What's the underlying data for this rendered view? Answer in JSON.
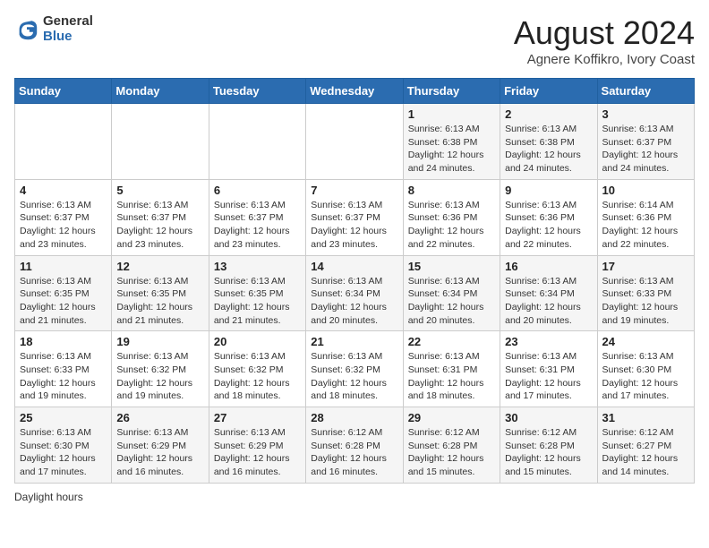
{
  "header": {
    "logo_general": "General",
    "logo_blue": "Blue",
    "month_title": "August 2024",
    "subtitle": "Agnere Koffikro, Ivory Coast"
  },
  "weekdays": [
    "Sunday",
    "Monday",
    "Tuesday",
    "Wednesday",
    "Thursday",
    "Friday",
    "Saturday"
  ],
  "weeks": [
    [
      {
        "day": "",
        "info": ""
      },
      {
        "day": "",
        "info": ""
      },
      {
        "day": "",
        "info": ""
      },
      {
        "day": "",
        "info": ""
      },
      {
        "day": "1",
        "info": "Sunrise: 6:13 AM\nSunset: 6:38 PM\nDaylight: 12 hours and 24 minutes."
      },
      {
        "day": "2",
        "info": "Sunrise: 6:13 AM\nSunset: 6:38 PM\nDaylight: 12 hours and 24 minutes."
      },
      {
        "day": "3",
        "info": "Sunrise: 6:13 AM\nSunset: 6:37 PM\nDaylight: 12 hours and 24 minutes."
      }
    ],
    [
      {
        "day": "4",
        "info": "Sunrise: 6:13 AM\nSunset: 6:37 PM\nDaylight: 12 hours and 23 minutes."
      },
      {
        "day": "5",
        "info": "Sunrise: 6:13 AM\nSunset: 6:37 PM\nDaylight: 12 hours and 23 minutes."
      },
      {
        "day": "6",
        "info": "Sunrise: 6:13 AM\nSunset: 6:37 PM\nDaylight: 12 hours and 23 minutes."
      },
      {
        "day": "7",
        "info": "Sunrise: 6:13 AM\nSunset: 6:37 PM\nDaylight: 12 hours and 23 minutes."
      },
      {
        "day": "8",
        "info": "Sunrise: 6:13 AM\nSunset: 6:36 PM\nDaylight: 12 hours and 22 minutes."
      },
      {
        "day": "9",
        "info": "Sunrise: 6:13 AM\nSunset: 6:36 PM\nDaylight: 12 hours and 22 minutes."
      },
      {
        "day": "10",
        "info": "Sunrise: 6:14 AM\nSunset: 6:36 PM\nDaylight: 12 hours and 22 minutes."
      }
    ],
    [
      {
        "day": "11",
        "info": "Sunrise: 6:13 AM\nSunset: 6:35 PM\nDaylight: 12 hours and 21 minutes."
      },
      {
        "day": "12",
        "info": "Sunrise: 6:13 AM\nSunset: 6:35 PM\nDaylight: 12 hours and 21 minutes."
      },
      {
        "day": "13",
        "info": "Sunrise: 6:13 AM\nSunset: 6:35 PM\nDaylight: 12 hours and 21 minutes."
      },
      {
        "day": "14",
        "info": "Sunrise: 6:13 AM\nSunset: 6:34 PM\nDaylight: 12 hours and 20 minutes."
      },
      {
        "day": "15",
        "info": "Sunrise: 6:13 AM\nSunset: 6:34 PM\nDaylight: 12 hours and 20 minutes."
      },
      {
        "day": "16",
        "info": "Sunrise: 6:13 AM\nSunset: 6:34 PM\nDaylight: 12 hours and 20 minutes."
      },
      {
        "day": "17",
        "info": "Sunrise: 6:13 AM\nSunset: 6:33 PM\nDaylight: 12 hours and 19 minutes."
      }
    ],
    [
      {
        "day": "18",
        "info": "Sunrise: 6:13 AM\nSunset: 6:33 PM\nDaylight: 12 hours and 19 minutes."
      },
      {
        "day": "19",
        "info": "Sunrise: 6:13 AM\nSunset: 6:32 PM\nDaylight: 12 hours and 19 minutes."
      },
      {
        "day": "20",
        "info": "Sunrise: 6:13 AM\nSunset: 6:32 PM\nDaylight: 12 hours and 18 minutes."
      },
      {
        "day": "21",
        "info": "Sunrise: 6:13 AM\nSunset: 6:32 PM\nDaylight: 12 hours and 18 minutes."
      },
      {
        "day": "22",
        "info": "Sunrise: 6:13 AM\nSunset: 6:31 PM\nDaylight: 12 hours and 18 minutes."
      },
      {
        "day": "23",
        "info": "Sunrise: 6:13 AM\nSunset: 6:31 PM\nDaylight: 12 hours and 17 minutes."
      },
      {
        "day": "24",
        "info": "Sunrise: 6:13 AM\nSunset: 6:30 PM\nDaylight: 12 hours and 17 minutes."
      }
    ],
    [
      {
        "day": "25",
        "info": "Sunrise: 6:13 AM\nSunset: 6:30 PM\nDaylight: 12 hours and 17 minutes."
      },
      {
        "day": "26",
        "info": "Sunrise: 6:13 AM\nSunset: 6:29 PM\nDaylight: 12 hours and 16 minutes."
      },
      {
        "day": "27",
        "info": "Sunrise: 6:13 AM\nSunset: 6:29 PM\nDaylight: 12 hours and 16 minutes."
      },
      {
        "day": "28",
        "info": "Sunrise: 6:12 AM\nSunset: 6:28 PM\nDaylight: 12 hours and 16 minutes."
      },
      {
        "day": "29",
        "info": "Sunrise: 6:12 AM\nSunset: 6:28 PM\nDaylight: 12 hours and 15 minutes."
      },
      {
        "day": "30",
        "info": "Sunrise: 6:12 AM\nSunset: 6:28 PM\nDaylight: 12 hours and 15 minutes."
      },
      {
        "day": "31",
        "info": "Sunrise: 6:12 AM\nSunset: 6:27 PM\nDaylight: 12 hours and 14 minutes."
      }
    ]
  ],
  "footer": {
    "daylight_label": "Daylight hours"
  }
}
